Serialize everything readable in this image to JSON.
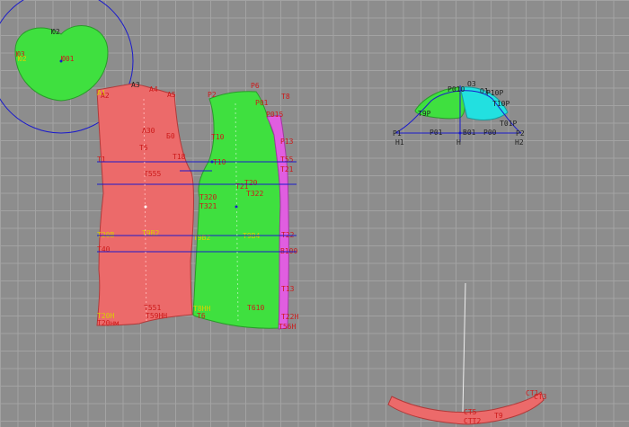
{
  "colors": {
    "background": "#8d8d8d",
    "grid": "#a3a3a3",
    "back_piece": "#ec6a6a",
    "front_piece": "#3fe03f",
    "facing_piece": "#e05ee0",
    "collar_piece": "#3fe03f",
    "sleeve_cap_left": "#3fe03f",
    "sleeve_cap_right": "#22e0e0",
    "waistband_piece": "#ec6a6a",
    "guide_line": "#1a1acc",
    "label_red": "#cc1a1a",
    "label_yellow": "#d8d000"
  },
  "collar_labels": {
    "top": "Ю2",
    "left1": "Ю3",
    "left2": "Ю2",
    "center": "Ю01"
  },
  "back_labels": {
    "a1": "А1",
    "a2": "А2",
    "a3": "А3",
    "a4": "А4",
    "a5": "А5",
    "b0": "Б0",
    "a30": "А30",
    "t5": "Т5",
    "t1": "Т1",
    "t18": "Т18",
    "t555": "Т555",
    "t20b": "Т20В",
    "t9b2": "Т9В2",
    "t40": "Т40",
    "t551": "Т551",
    "t59hh": "Т59НН",
    "t20h": "Т20Н",
    "t20hm": "Т20нм"
  },
  "front_labels": {
    "p2": "Р2",
    "p6": "Р6",
    "t10": "Т10",
    "t10b": "Т10",
    "t20": "Т20",
    "t21": "Т21",
    "t320": "Т320",
    "t321": "Т321",
    "t322": "Т322",
    "t9b2": "Т9В2",
    "t9b4": "Т9В4",
    "t8hh": "Т8НН",
    "t610": "Т610",
    "t6": "Т6",
    "t8": "Т8",
    "p01": "Р01",
    "p015": "Р015",
    "p13": "Р13",
    "t55": "Т55",
    "t22": "Т22",
    "b100": "В100",
    "t13": "Т13",
    "t22h": "Т22Н",
    "t56h": "Т56Н",
    "t21b": "Т21"
  },
  "sleeve_labels": {
    "p1": "Р1",
    "p2": "Р2",
    "h1": "Н1",
    "h2": "Н2",
    "p01": "Р01",
    "p00": "Р00",
    "b01": "В01",
    "h": "Н",
    "o3": "О3",
    "o1": "О1",
    "p010": "Р010",
    "p10p": "Р10Р",
    "t10p": "Т10Р",
    "t9p": "Т9Р",
    "t01p": "Т01Р"
  },
  "waistband_labels": {
    "left": "СТ5",
    "mid": "Т9",
    "bottom": "СТТ2",
    "right1": "СТ1",
    "right2": "СТ3"
  }
}
